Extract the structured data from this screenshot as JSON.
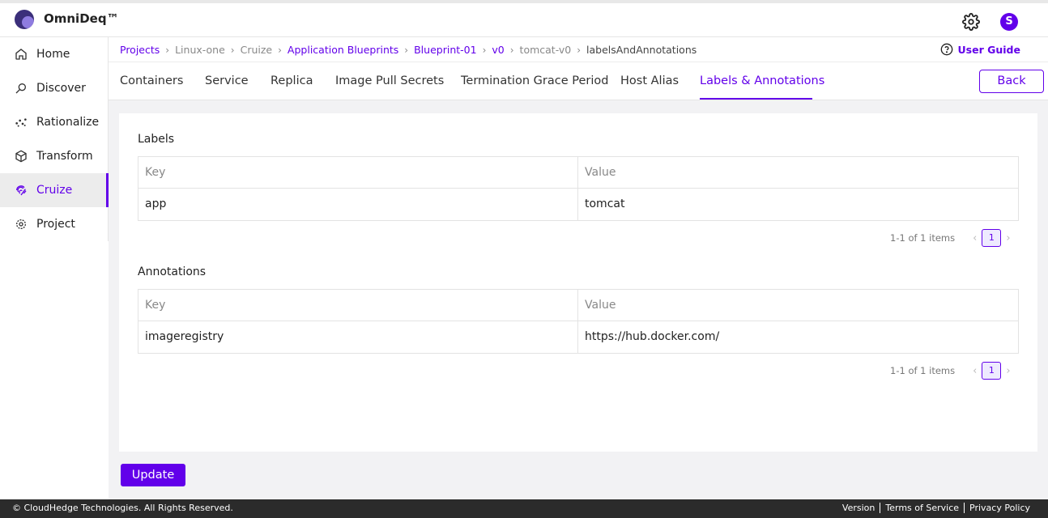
{
  "app": {
    "brand": "OmniDeq™",
    "avatar_initial": "S"
  },
  "sidebar": {
    "items": [
      {
        "label": "Home",
        "icon": "home-icon"
      },
      {
        "label": "Discover",
        "icon": "discover-icon"
      },
      {
        "label": "Rationalize",
        "icon": "rationalize-icon"
      },
      {
        "label": "Transform",
        "icon": "cube-icon"
      },
      {
        "label": "Cruize",
        "icon": "fingerprint-icon",
        "active": true
      },
      {
        "label": "Project",
        "icon": "gear-icon"
      }
    ]
  },
  "breadcrumb": {
    "items": [
      "Projects",
      "Linux-one",
      "Cruize",
      "Application Blueprints",
      "Blueprint-01",
      "v0",
      "tomcat-v0",
      "labelsAndAnnotations"
    ]
  },
  "user_guide": "User Guide",
  "tabs": [
    "Containers",
    "Service",
    "Replica",
    "Image Pull Secrets",
    "Termination Grace Period",
    "Host Alias",
    "Labels & Annotations"
  ],
  "active_tab": "Labels & Annotations",
  "back_label": "Back",
  "labels": {
    "title": "Labels",
    "headers": [
      "Key",
      "Value"
    ],
    "rows": [
      [
        "app",
        "tomcat"
      ]
    ],
    "pagination": {
      "info": "1-1 of 1 items",
      "page": "1"
    }
  },
  "annotations": {
    "title": "Annotations",
    "headers": [
      "Key",
      "Value"
    ],
    "rows": [
      [
        "imageregistry",
        "https://hub.docker.com/"
      ]
    ],
    "pagination": {
      "info": "1-1 of 1 items",
      "page": "1"
    }
  },
  "update_label": "Update",
  "footer": {
    "copyright": "© CloudHedge Technologies. All Rights Reserved.",
    "links": [
      "Version",
      "Terms of Service",
      "Privacy Policy"
    ]
  },
  "colors": {
    "accent": "#6200ea",
    "footer_bg": "#2b2b2b",
    "page_bg": "#f2f2f4"
  }
}
